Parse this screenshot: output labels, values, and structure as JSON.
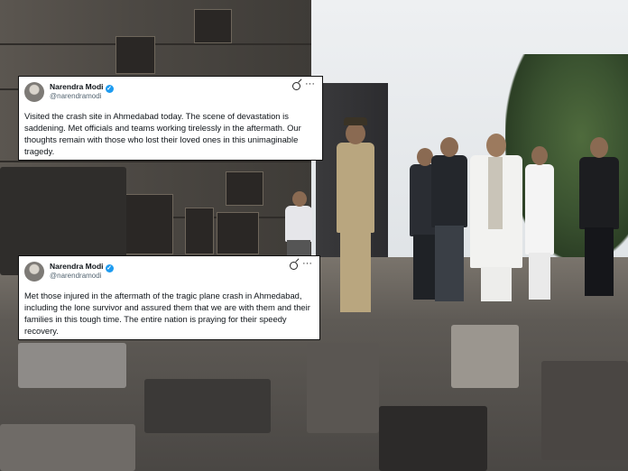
{
  "tweets": [
    {
      "author_name": "Narendra Modi",
      "author_handle": "@narendramodi",
      "verified_icon": "verified-badge-icon",
      "text": "Visited the crash site in Ahmedabad today. The scene of devastation is saddening. Met officials and teams working tirelessly in the aftermath. Our thoughts remain with those who lost their loved ones in this unimaginable tragedy."
    },
    {
      "author_name": "Narendra Modi",
      "author_handle": "@narendramodi",
      "verified_icon": "verified-badge-icon",
      "text": "Met those injured in the aftermath of the tragic plane crash in Ahmedabad, including the lone survivor and assured them that we are with them and their families in this tough time. The entire nation is praying for their speedy recovery."
    }
  ],
  "colors": {
    "verified_blue": "#1d9bf0",
    "handle_gray": "#536471",
    "text_black": "#0f1419"
  }
}
